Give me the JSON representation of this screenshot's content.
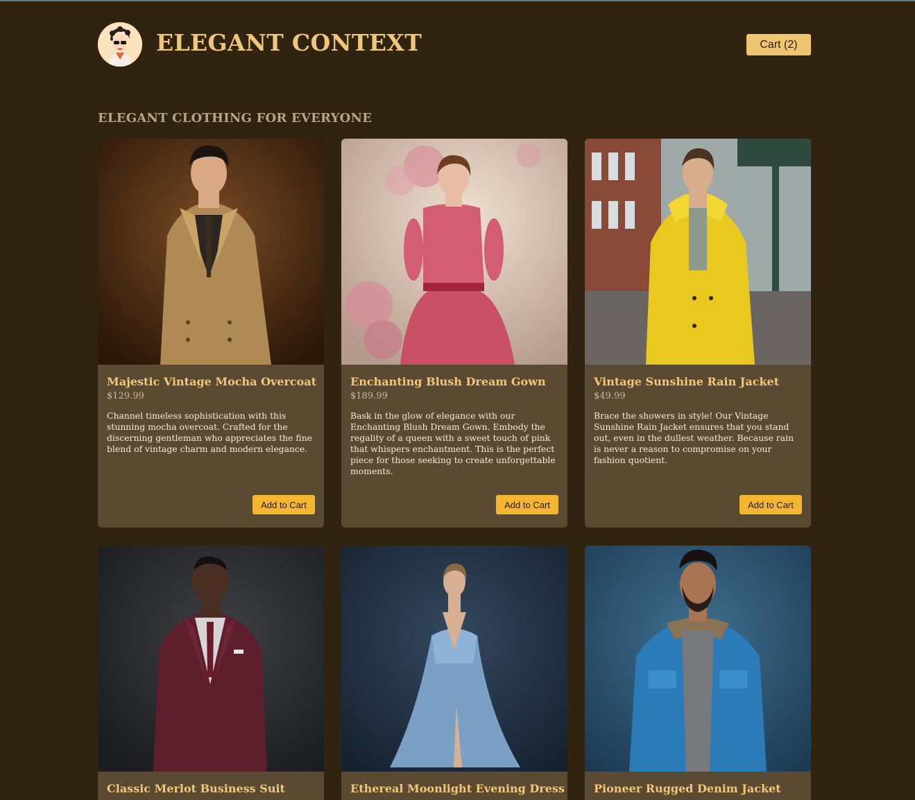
{
  "header": {
    "site_title": "ELEGANT CONTEXT",
    "cart_label": "Cart (2)"
  },
  "section_heading": "ELEGANT CLOTHING FOR EVERYONE",
  "products": [
    {
      "name": "Majestic Vintage Mocha Overcoat",
      "price": "$129.99",
      "description": "Channel timeless sophistication with this stunning mocha overcoat. Crafted for the discerning gentleman who appreciates the fine blend of vintage charm and modern elegance.",
      "button": "Add to Cart"
    },
    {
      "name": "Enchanting Blush Dream Gown",
      "price": "$189.99",
      "description": "Bask in the glow of elegance with our Enchanting Blush Dream Gown. Embody the regality of a queen with a sweet touch of pink that whispers enchantment. This is the perfect piece for those seeking to create unforgettable moments.",
      "button": "Add to Cart"
    },
    {
      "name": "Vintage Sunshine Rain Jacket",
      "price": "$49.99",
      "description": "Brace the showers in style! Our Vintage Sunshine Rain Jacket ensures that you stand out, even in the dullest weather. Because rain is never a reason to compromise on your fashion quotient.",
      "button": "Add to Cart"
    },
    {
      "name": "Classic Merlot Business Suit",
      "price": "",
      "description": "",
      "button": ""
    },
    {
      "name": "Ethereal Moonlight Evening Dress",
      "price": "",
      "description": "",
      "button": ""
    },
    {
      "name": "Pioneer Rugged Denim Jacket",
      "price": "",
      "description": "",
      "button": ""
    }
  ]
}
